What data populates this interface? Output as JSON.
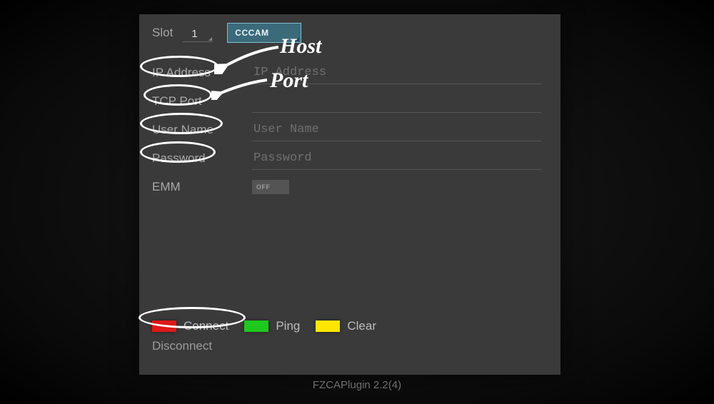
{
  "top": {
    "slot_label": "Slot",
    "slot_value": "1",
    "protocol": "CCCAM"
  },
  "form": {
    "ip_label": "IP Address",
    "ip_placeholder": "IP Address",
    "port_label": "TCP Port",
    "user_label": "User Name",
    "user_placeholder": "User Name",
    "pass_label": "Password",
    "pass_placeholder": "Password",
    "emm_label": "EMM",
    "emm_value": "OFF"
  },
  "actions": {
    "connect": "Connect",
    "ping": "Ping",
    "clear": "Clear",
    "disconnect": "Disconnect"
  },
  "footer": "FZCAPlugin 2.2(4)",
  "annotations": {
    "host": "Host",
    "port": "Port"
  }
}
